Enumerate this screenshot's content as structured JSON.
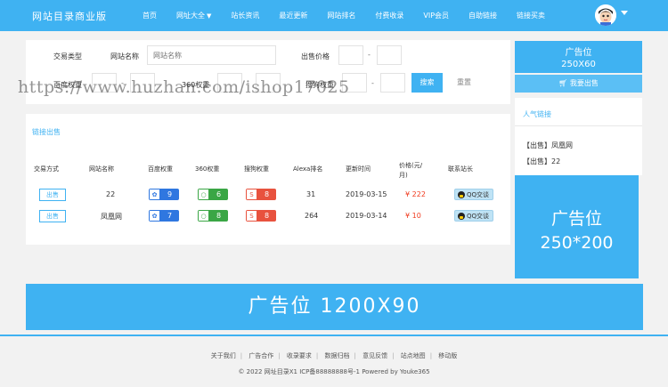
{
  "header": {
    "logo": "网站目录商业版",
    "nav": [
      {
        "label": "首页"
      },
      {
        "label": "网址大全"
      },
      {
        "label": "站长资讯"
      },
      {
        "label": "最近更新"
      },
      {
        "label": "网站排名"
      },
      {
        "label": "付费收录"
      },
      {
        "label": "VIP会员"
      },
      {
        "label": "自助链接"
      },
      {
        "label": "链接买卖"
      }
    ]
  },
  "filter": {
    "trade_type_label": "交易类型",
    "site_name_label": "网站名称",
    "site_name_placeholder": "网站名称",
    "price_label": "出售价格",
    "baidu_label": "百度权重",
    "w360_label": "360权重",
    "sogou_label": "搜狗权重",
    "range_sep": "-",
    "search_label": "搜索",
    "reset_label": "重置"
  },
  "links_panel": {
    "title": "链接出售",
    "columns": [
      "交易方式",
      "网站名称",
      "百度权重",
      "360权重",
      "搜狗权重",
      "Alexa排名",
      "更新时间",
      "价格(元/月)",
      "联系站长"
    ],
    "price_col_line1": "价格(元/",
    "price_col_line2": "月)",
    "rows": [
      {
        "mode": "出售",
        "name": "22",
        "baidu": "9",
        "w360": "6",
        "sogou": "8",
        "alexa": "31",
        "updated": "2019-03-15",
        "price": "¥ 222",
        "contact": "QQ交谈"
      },
      {
        "mode": "出售",
        "name": "凤凰网",
        "baidu": "7",
        "w360": "8",
        "sogou": "8",
        "alexa": "264",
        "updated": "2019-03-14",
        "price": "¥ 10",
        "contact": "QQ交谈"
      }
    ]
  },
  "sidebar": {
    "ad_small_line1": "广告位",
    "ad_small_line2": "250X60",
    "sell_link": "我要出售",
    "popular_title": "人气链接",
    "popular_items": [
      "【出售】凤凰网",
      "【出售】22"
    ],
    "ad_mid_line1": "广告位",
    "ad_mid_line2": "250*200"
  },
  "ad_wide": "广告位 1200X90",
  "footer": {
    "links": [
      "关于我们",
      "广告合作",
      "收录要求",
      "数据归档",
      "意见反馈",
      "站点地图",
      "移动版"
    ],
    "copyright": "© 2022 网址目录X1 ICP备88888888号-1 Powered by Youke365"
  },
  "watermark": "https://www.huzhan.com/ishop17025",
  "colors": {
    "primary": "#3fb2f2",
    "baidu": "#2f77e0",
    "w360": "#3aa645",
    "sogou": "#e8523e",
    "price": "#f03a1e"
  }
}
